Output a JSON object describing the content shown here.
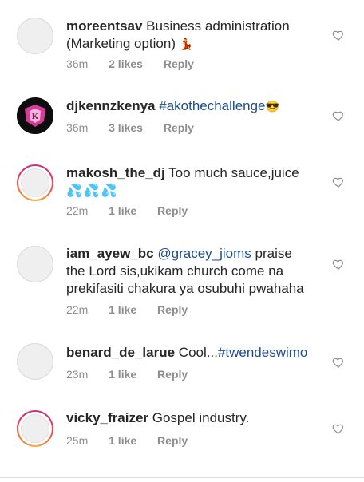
{
  "comments": [
    {
      "username": "moreentsav",
      "text_before": " Business administration (Marketing option)",
      "emoji": "💃",
      "time": "36m",
      "likes": "2 likes",
      "reply": "Reply",
      "avatar": "default"
    },
    {
      "username": "djkennzkenya",
      "hashtag": "#akothechallenge",
      "emoji": "😎",
      "time": "36m",
      "likes": "3 likes",
      "reply": "Reply",
      "avatar": "brand"
    },
    {
      "username": "makosh_the_dj",
      "text_before": " Too much sauce,juice",
      "emoji": "💦💦💦",
      "time": "22m",
      "likes": "1 like",
      "reply": "Reply",
      "avatar": "story"
    },
    {
      "username": "iam_ayew_bc",
      "mention": "@gracey_jioms",
      "text_after": " praise the Lord sis,ukikam church come na prekifasiti chakura ya osubuhi pwahaha",
      "time": "22m",
      "likes": "1 like",
      "reply": "Reply",
      "avatar": "default"
    },
    {
      "username": "benard_de_larue",
      "text_before": " Cool...",
      "hashtag": "#twendeswimo",
      "time": "23m",
      "likes": "1 like",
      "reply": "Reply",
      "avatar": "default"
    },
    {
      "username": "vicky_fraizer",
      "text_before": " Gospel industry.",
      "time": "25m",
      "likes": "1 like",
      "reply": "Reply",
      "avatar": "story"
    }
  ],
  "colors": {
    "link": "#1e4d8c",
    "meta": "#8e8e8e",
    "text": "#262626"
  },
  "icons": {
    "like": "heart-outline-icon"
  }
}
